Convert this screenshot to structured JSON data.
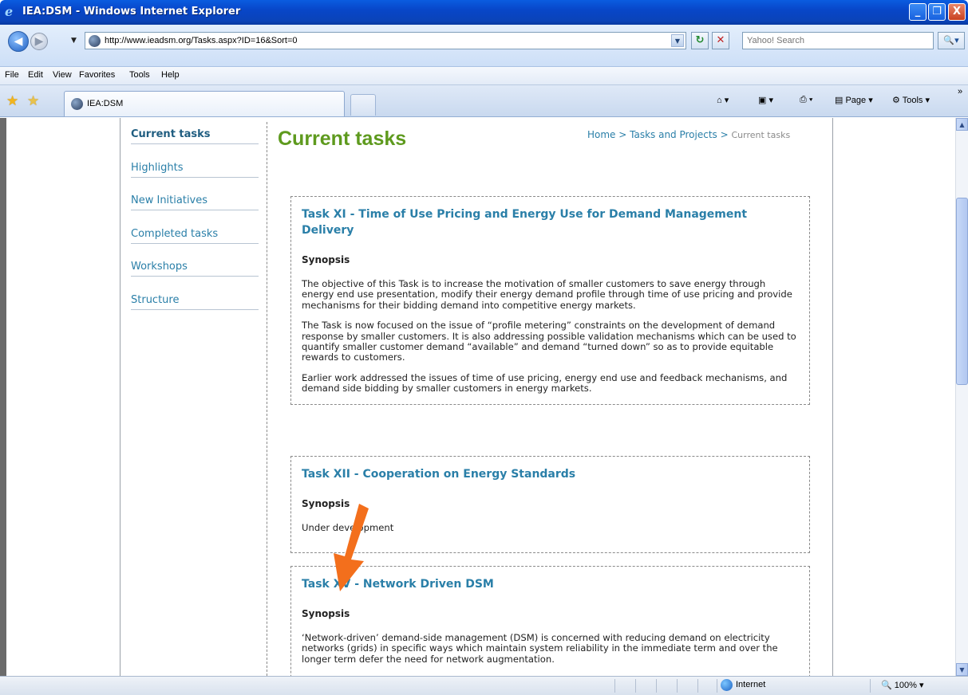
{
  "window": {
    "title": "IEA:DSM - Windows Internet Explorer",
    "buttons": {
      "minimize": "_",
      "maximize": "❐",
      "close": "X"
    }
  },
  "address_bar": {
    "url": "http://www.ieadsm.org/Tasks.aspx?ID=16&Sort=0",
    "search_placeholder": "Yahoo! Search"
  },
  "menu": [
    "File",
    "Edit",
    "View",
    "Favorites",
    "Tools",
    "Help"
  ],
  "tab": {
    "label": "IEA:DSM"
  },
  "command_bar": {
    "page": "Page",
    "tools": "Tools"
  },
  "left_nav": [
    {
      "label": "Current tasks",
      "active": true
    },
    {
      "label": "Highlights"
    },
    {
      "label": "New Initiatives"
    },
    {
      "label": "Completed tasks"
    },
    {
      "label": "Workshops"
    },
    {
      "label": "Structure"
    }
  ],
  "page": {
    "title": "Current tasks",
    "breadcrumb": {
      "home": "Home",
      "sep1": " > ",
      "section": "Tasks and Projects",
      "sep2": " > ",
      "current": "Current tasks"
    }
  },
  "tasks": [
    {
      "title": "Task XI - Time of Use Pricing and Energy Use for Demand Management Delivery",
      "synopsis_label": "Synopsis",
      "paragraphs": [
        "The objective of this Task is to increase the motivation of smaller customers to save energy through energy end use presentation, modify their energy demand profile through time of use pricing and provide mechanisms for their bidding demand into competitive energy markets.",
        "The Task is now focused on the issue of “profile metering” constraints on the development of demand response by smaller customers. It is also addressing possible validation mechanisms which can be used to quantify smaller customer demand “available” and demand “turned down” so as to provide equitable rewards to customers.",
        "Earlier work addressed the issues of time of use pricing, energy end use and feedback mechanisms, and demand side bidding by smaller customers in energy markets."
      ]
    },
    {
      "title": "Task XII - Cooperation on Energy Standards",
      "synopsis_label": "Synopsis",
      "paragraphs": [
        "Under development"
      ]
    },
    {
      "title": "Task XV - Network Driven DSM",
      "synopsis_label": "Synopsis",
      "paragraphs": [
        "‘Network-driven’ demand-side management (DSM) is concerned with reducing demand on electricity networks (grids) in specific ways which maintain system reliability in the immediate term and over the longer term defer the need for network augmentation."
      ]
    }
  ],
  "status_bar": {
    "zone": "Internet",
    "zoom": "100%"
  },
  "colors": {
    "title_green": "#5e9a1e",
    "link_blue": "#2a7fa8",
    "annotation_orange": "#f36f1c"
  }
}
